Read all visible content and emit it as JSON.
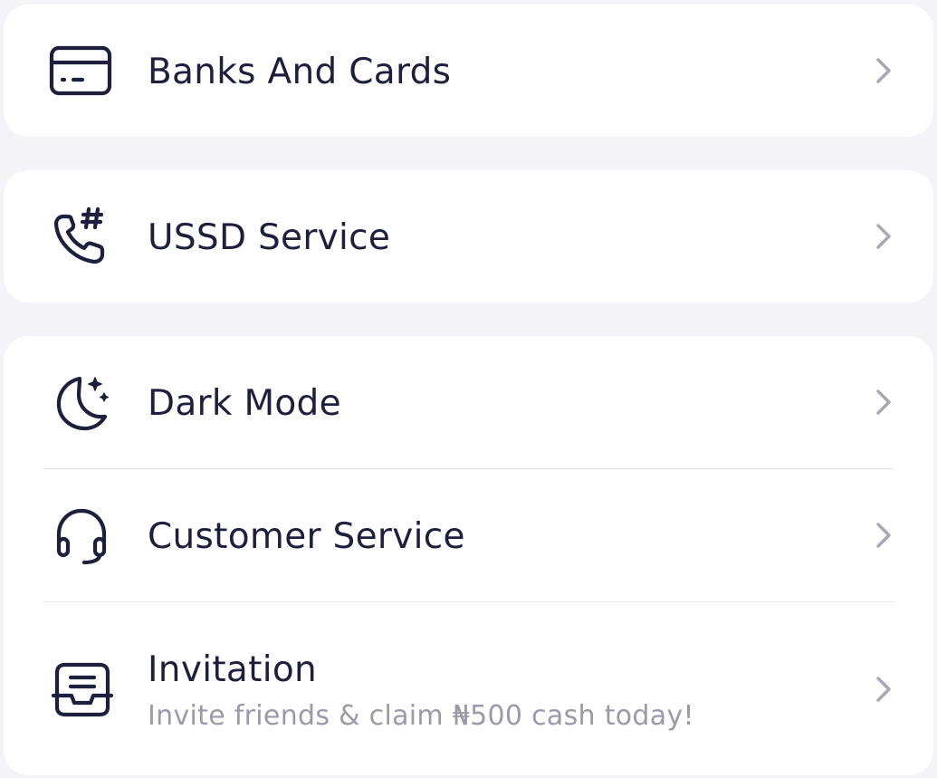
{
  "menu": {
    "banks": {
      "label": "Banks And Cards",
      "icon": "credit-card-icon"
    },
    "ussd": {
      "label": "USSD Service",
      "icon": "phone-hash-icon"
    },
    "dark_mode": {
      "label": "Dark Mode",
      "icon": "moon-stars-icon"
    },
    "customer_service": {
      "label": "Customer Service",
      "icon": "headset-icon"
    },
    "invitation": {
      "label": "Invitation",
      "subtitle": "Invite friends & claim ₦500 cash today!",
      "icon": "inbox-tray-icon"
    }
  },
  "colors": {
    "background": "#f4f4f8",
    "card": "#ffffff",
    "text": "#1e1f3d",
    "subtext": "#9a9aa8",
    "chevron": "#a8a8b4"
  }
}
